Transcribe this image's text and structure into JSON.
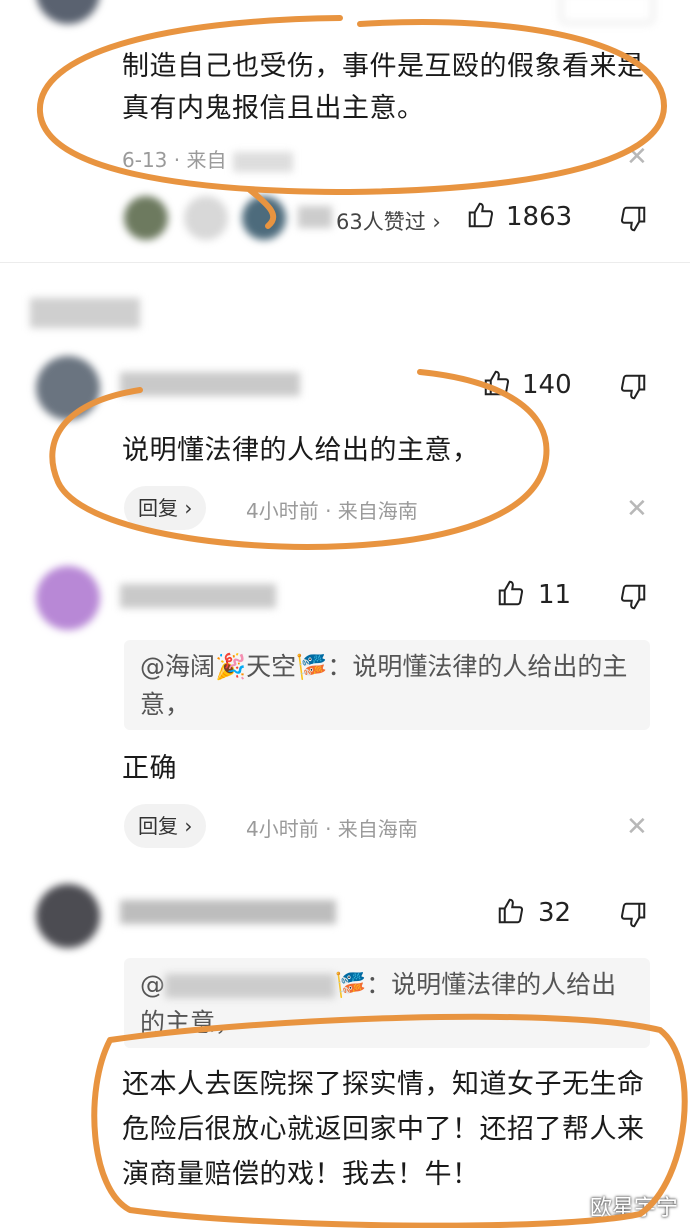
{
  "comment1": {
    "text": "制造自己也受伤，事件是互殴的假象看来是真有内鬼报信且出主意。",
    "date": "6-13",
    "from_prefix": "· 来自",
    "likers_suffix": "63人赞过 ›",
    "likes": "1863"
  },
  "comment2": {
    "likes": "140",
    "text": "说明懂法律的人给出的主意，",
    "reply_label": "回复 ›",
    "time": "4小时前",
    "location": "· 来自海南"
  },
  "comment3": {
    "likes": "11",
    "quote_mention": "@海阔",
    "quote_mid": "天空",
    "quote_text": "说明懂法律的人给出的主意，",
    "text": "正确",
    "reply_label": "回复 ›",
    "time": "4小时前",
    "location": "· 来自海南"
  },
  "comment4": {
    "likes": "32",
    "quote_mention": "@",
    "quote_text": "说明懂法律的人给出的主意，",
    "text": "还本人去医院探了探实情，知道女子无生命危险后很放心就返回家中了！还招了帮人来演商量赔偿的戏！我去！牛！"
  },
  "watermark": "欧星宇宁",
  "colors": {
    "annotation": "#e89440",
    "text": "#1a1a1a",
    "meta": "#9a9a9a"
  }
}
